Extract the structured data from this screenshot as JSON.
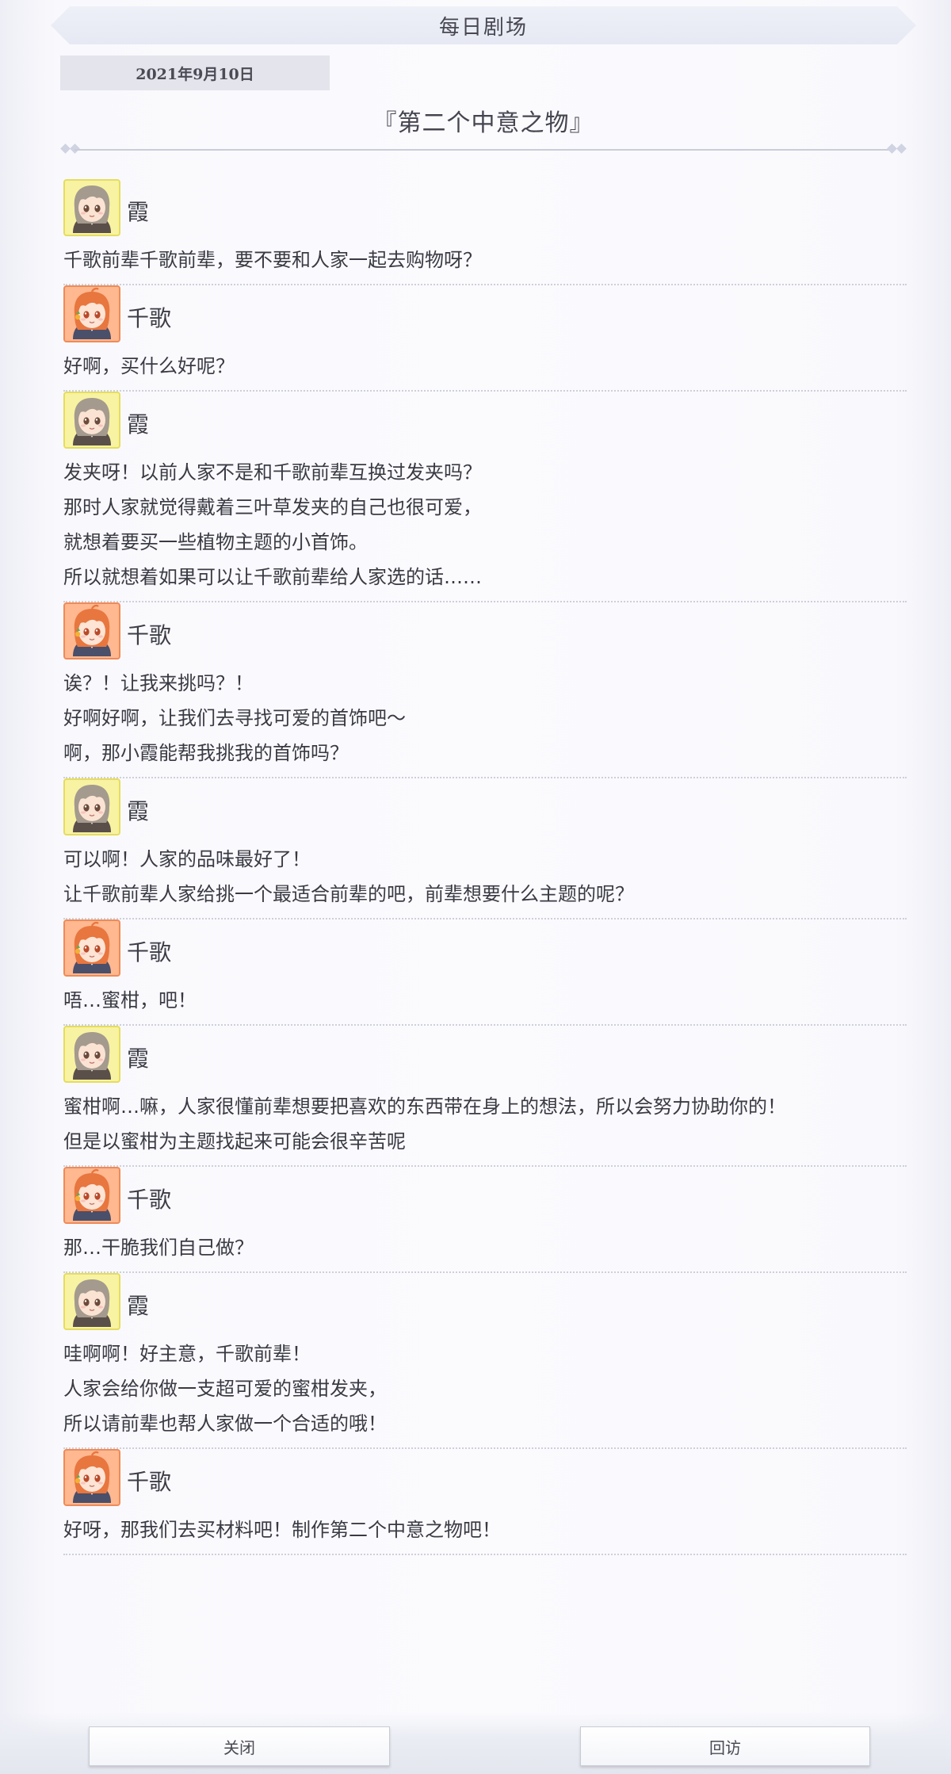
{
  "header": {
    "title": "每日剧场"
  },
  "date": "2021年9月10日",
  "story_title": "『第二个中意之物』",
  "conversation": [
    {
      "speaker": "霞",
      "avatar": "kasumi",
      "lines": [
        "千歌前辈千歌前辈，要不要和人家一起去购物呀？"
      ]
    },
    {
      "speaker": "千歌",
      "avatar": "chika",
      "lines": [
        "好啊，买什么好呢？"
      ]
    },
    {
      "speaker": "霞",
      "avatar": "kasumi",
      "lines": [
        "发夹呀！以前人家不是和千歌前辈互换过发夹吗？",
        "那时人家就觉得戴着三叶草发夹的自己也很可爱，",
        "就想着要买一些植物主题的小首饰。",
        "所以就想着如果可以让千歌前辈给人家选的话……"
      ]
    },
    {
      "speaker": "千歌",
      "avatar": "chika",
      "lines": [
        "诶？！让我来挑吗？！",
        "好啊好啊，让我们去寻找可爱的首饰吧～",
        "啊，那小霞能帮我挑我的首饰吗？"
      ]
    },
    {
      "speaker": "霞",
      "avatar": "kasumi",
      "lines": [
        "可以啊！人家的品味最好了！",
        "让千歌前辈人家给挑一个最适合前辈的吧，前辈想要什么主题的呢？"
      ]
    },
    {
      "speaker": "千歌",
      "avatar": "chika",
      "lines": [
        "唔…蜜柑，吧！"
      ]
    },
    {
      "speaker": "霞",
      "avatar": "kasumi",
      "lines": [
        "蜜柑啊…嘛，人家很懂前辈想要把喜欢的东西带在身上的想法，所以会努力协助你的！",
        "但是以蜜柑为主题找起来可能会很辛苦呢"
      ]
    },
    {
      "speaker": "千歌",
      "avatar": "chika",
      "lines": [
        "那…干脆我们自己做？"
      ]
    },
    {
      "speaker": "霞",
      "avatar": "kasumi",
      "lines": [
        "哇啊啊！好主意，千歌前辈！",
        "人家会给你做一支超可爱的蜜柑发夹，",
        "所以请前辈也帮人家做一个合适的哦！"
      ]
    },
    {
      "speaker": "千歌",
      "avatar": "chika",
      "lines": [
        "好呀，那我们去买材料吧！制作第二个中意之物吧！"
      ]
    }
  ],
  "buttons": {
    "close": "关闭",
    "revisit": "回访"
  },
  "colors": {
    "kasumi_avatar_bg": "#f8f3a2",
    "chika_avatar_bg": "#ffb88f",
    "header_bg": "#eef0f8"
  },
  "icons": {
    "kasumi": "kasumi-avatar-icon",
    "chika": "chika-avatar-icon"
  }
}
